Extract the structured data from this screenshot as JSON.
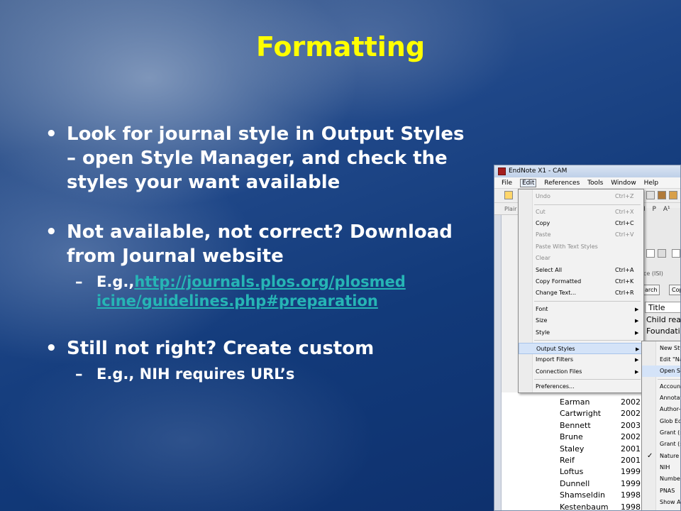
{
  "slide": {
    "title": "Formatting",
    "bullets": [
      {
        "text": "Look for journal style in Output Styles – open Style Manager, and check the styles your want available"
      },
      {
        "text": "Not available, not correct? Download from Journal website"
      },
      {
        "text": "Still not right? Create custom"
      }
    ],
    "bullet_glyph": "•",
    "dash_glyph": "–",
    "sub1_prefix": "E.g.,",
    "sub1_link_line1": "http://journals.plos.org/plosmed",
    "sub1_link_line2": "icine/guidelines.php#preparation",
    "sub2_text": "E.g., NIH requires URL’s",
    "colors": {
      "title": "#ffff00",
      "text": "#ffffff",
      "link": "#26b5b5"
    }
  },
  "window": {
    "title": "EndNote X1 - CAM",
    "menus": [
      "File",
      "Edit",
      "References",
      "Tools",
      "Window",
      "Help"
    ],
    "toolbar2_text": "Plair",
    "format_buttons": [
      "I",
      "P",
      "A¹"
    ],
    "isi_text": "ce (ISI)",
    "search_btn": "arch",
    "copy_btn": "Cop",
    "title_header": "Title",
    "title_rows": [
      "Child rea",
      "Foundatio"
    ]
  },
  "edit_menu": [
    {
      "label": "Undo",
      "shortcut": "Ctrl+Z",
      "disabled": true
    },
    {
      "label": "Cut",
      "shortcut": "Ctrl+X",
      "disabled": true
    },
    {
      "label": "Copy",
      "shortcut": "Ctrl+C"
    },
    {
      "label": "Paste",
      "shortcut": "Ctrl+V",
      "disabled": true
    },
    {
      "label": "Paste With Text Styles",
      "disabled": true
    },
    {
      "label": "Clear",
      "disabled": true
    },
    {
      "label": "Select All",
      "shortcut": "Ctrl+A"
    },
    {
      "label": "Copy Formatted",
      "shortcut": "Ctrl+K"
    },
    {
      "label": "Change Text...",
      "shortcut": "Ctrl+R"
    },
    {
      "label": "Font"
    },
    {
      "label": "Size"
    },
    {
      "label": "Style"
    },
    {
      "label": "Output Styles"
    },
    {
      "label": "Import Filters"
    },
    {
      "label": "Connection Files"
    },
    {
      "label": "Preferences..."
    }
  ],
  "submenu": [
    "New Sty",
    "Edit \"Na",
    "Open St",
    "Accoun",
    "Annotat",
    "Author-",
    "Glob Ec",
    "Grant (s",
    "Grant (s",
    "Nature M",
    "NIH",
    "Number",
    "PNAS",
    "Show Al"
  ],
  "submenu_check": "✓",
  "arrow_glyph": "▶",
  "authors": [
    {
      "name": "Earman",
      "year": "2002"
    },
    {
      "name": "Cartwright",
      "year": "2002"
    },
    {
      "name": "Bennett",
      "year": "2003"
    },
    {
      "name": "Brune",
      "year": "2002"
    },
    {
      "name": "Staley",
      "year": "2001"
    },
    {
      "name": "Reif",
      "year": "2001"
    },
    {
      "name": "Loftus",
      "year": "1999"
    },
    {
      "name": "Dunnell",
      "year": "1999"
    },
    {
      "name": "Shamseldin",
      "year": "1998"
    },
    {
      "name": "Kestenbaum",
      "year": "1998"
    }
  ]
}
